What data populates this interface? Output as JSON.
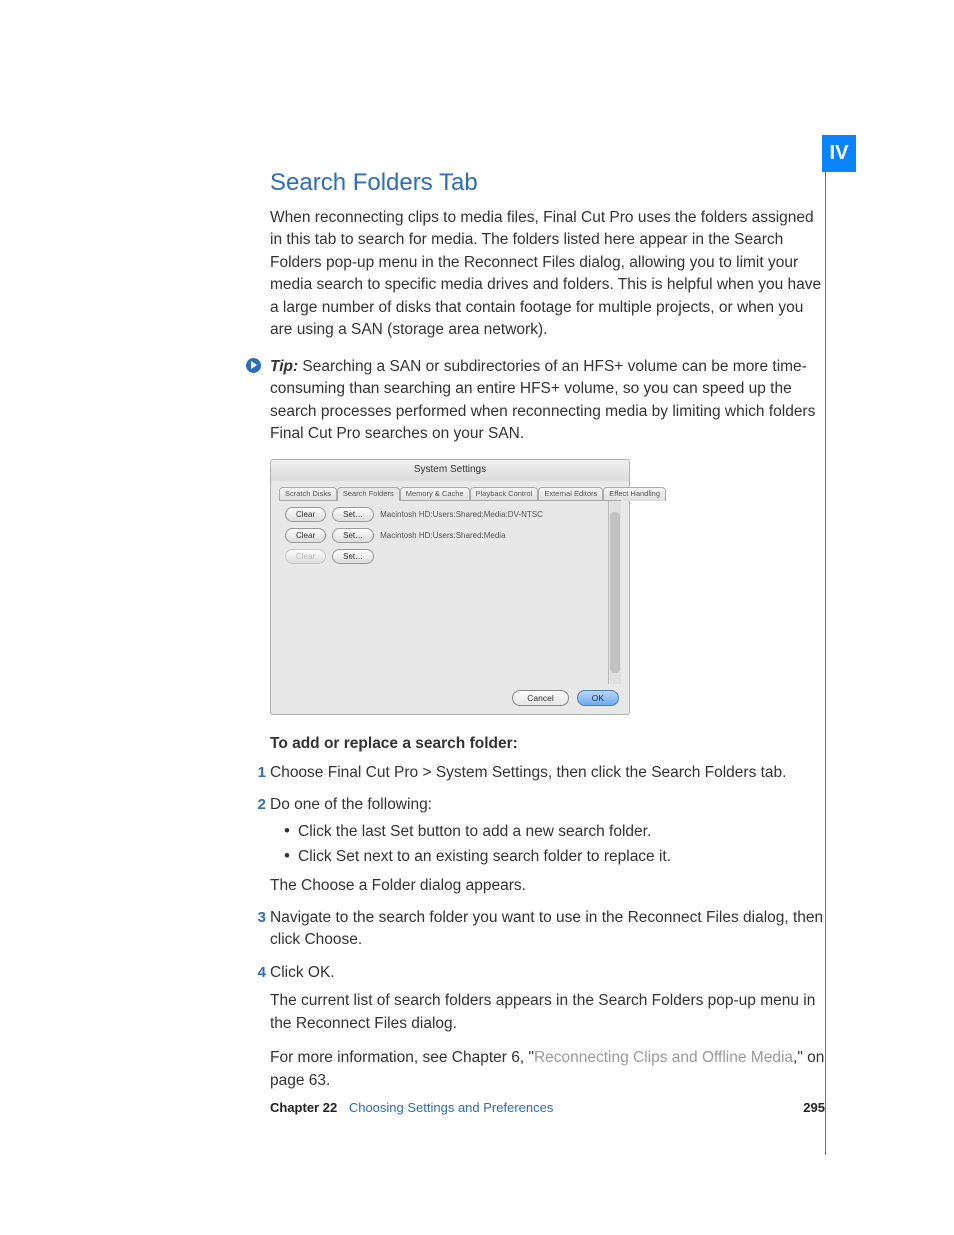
{
  "partMarker": "IV",
  "heading": "Search Folders Tab",
  "intro": "When reconnecting clips to media files, Final Cut Pro uses the folders assigned in this tab to search for media. The folders listed here appear in the Search Folders pop-up menu in the Reconnect Files dialog, allowing you to limit your media search to specific media drives and folders. This is helpful when you have a large number of disks that contain footage for multiple projects, or when you are using a SAN (storage area network).",
  "tip": {
    "label": "Tip:",
    "text": "  Searching a SAN or subdirectories of an HFS+ volume can be more time-consuming than searching an entire HFS+ volume, so you can speed up the search processes performed when reconnecting media by limiting which folders Final Cut Pro searches on your SAN."
  },
  "window": {
    "title": "System Settings",
    "tabs": [
      "Scratch Disks",
      "Search Folders",
      "Memory & Cache",
      "Playback Control",
      "External Editors",
      "Effect Handling"
    ],
    "rows": [
      {
        "clear": "Clear",
        "set": "Set…",
        "path": "Macintosh HD:Users:Shared:Media:DV-NTSC"
      },
      {
        "clear": "Clear",
        "set": "Set…",
        "path": "Macintosh HD:Users:Shared:Media"
      },
      {
        "clear": "Clear",
        "set": "Set…",
        "path": ""
      }
    ],
    "cancel": "Cancel",
    "ok": "OK"
  },
  "procHeading": "To add or replace a search folder:",
  "steps": {
    "s1": "Choose Final Cut Pro > System Settings, then click the Search Folders tab.",
    "s2": "Do one of the following:",
    "s2a": "Click the last Set button to add a new search folder.",
    "s2b": "Click Set next to an existing search folder to replace it.",
    "s2after": "The Choose a Folder dialog appears.",
    "s3": "Navigate to the search folder you want to use in the Reconnect Files dialog, then click Choose.",
    "s4": "Click OK.",
    "after1": "The current list of search folders appears in the Search Folders pop-up menu in the Reconnect Files dialog.",
    "after2a": "For more information, see Chapter 6, \"",
    "after2link": "Reconnecting Clips and Offline Media",
    "after2b": ",\" on page 63."
  },
  "footer": {
    "chapNum": "Chapter 22",
    "chapTitle": "Choosing Settings and Preferences",
    "pageNum": "295"
  }
}
